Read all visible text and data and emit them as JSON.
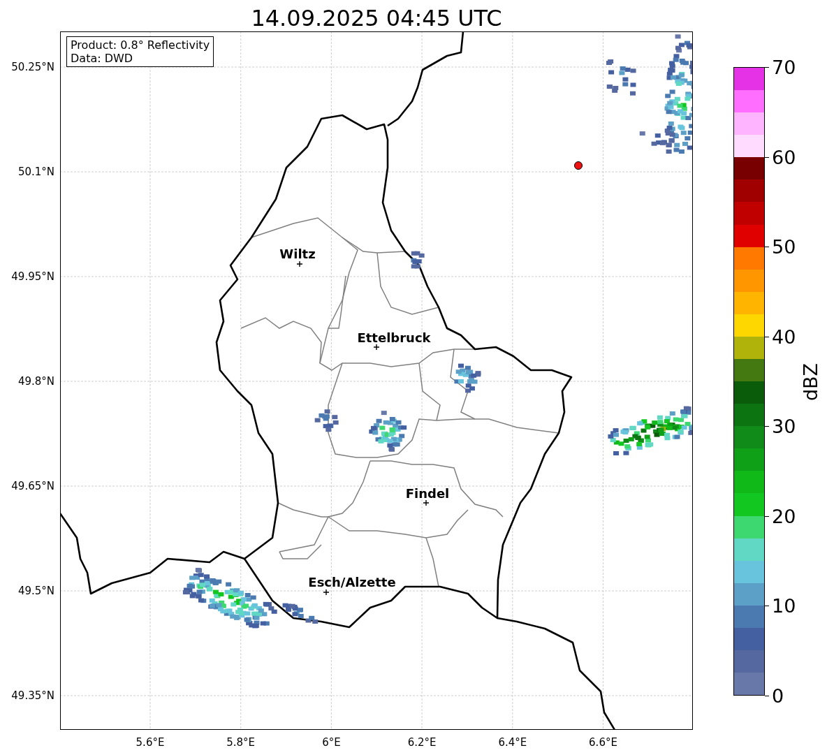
{
  "title": "14.09.2025 04:45 UTC",
  "info_box": {
    "lines": [
      "Product: 0.8° Reflectivity",
      "Data: DWD"
    ]
  },
  "map": {
    "yticks": [
      "50.25°N",
      "50.1°N",
      "49.95°N",
      "49.8°N",
      "49.65°N",
      "49.5°N",
      "49.35°N"
    ],
    "xticks": [
      "5.6°E",
      "5.8°E",
      "6°E",
      "6.2°E",
      "6.4°E",
      "6.6°E"
    ],
    "cities": [
      {
        "name": "Wiltz"
      },
      {
        "name": "Ettelbruck"
      },
      {
        "name": "Findel"
      },
      {
        "name": "Esch/Alzette"
      }
    ]
  },
  "colorbar": {
    "label": "dBZ",
    "ticks": [
      "70",
      "60",
      "50",
      "40",
      "30",
      "20",
      "10",
      "0"
    ],
    "colors": [
      {
        "color": "#e632e6"
      },
      {
        "color": "#ff6eff"
      },
      {
        "color": "#ffb4ff"
      },
      {
        "color": "#ffdcff"
      },
      {
        "color": "#780000"
      },
      {
        "color": "#a00000"
      },
      {
        "color": "#c00000"
      },
      {
        "color": "#e00000"
      },
      {
        "color": "#ff7800"
      },
      {
        "color": "#ff9600"
      },
      {
        "color": "#ffb400"
      },
      {
        "color": "#ffd700"
      },
      {
        "color": "#b0b40a"
      },
      {
        "color": "#447810"
      },
      {
        "color": "#0a5c0a"
      },
      {
        "color": "#0c7410"
      },
      {
        "color": "#108a18"
      },
      {
        "color": "#10a018"
      },
      {
        "color": "#10b818"
      },
      {
        "color": "#12c820"
      },
      {
        "color": "#3dd870"
      },
      {
        "color": "#60d8c4"
      },
      {
        "color": "#68c4dc"
      },
      {
        "color": "#5ca0c8"
      },
      {
        "color": "#4a7ab0"
      },
      {
        "color": "#4560a0"
      },
      {
        "color": "#5569a0"
      },
      {
        "color": "#6878a8"
      }
    ]
  }
}
